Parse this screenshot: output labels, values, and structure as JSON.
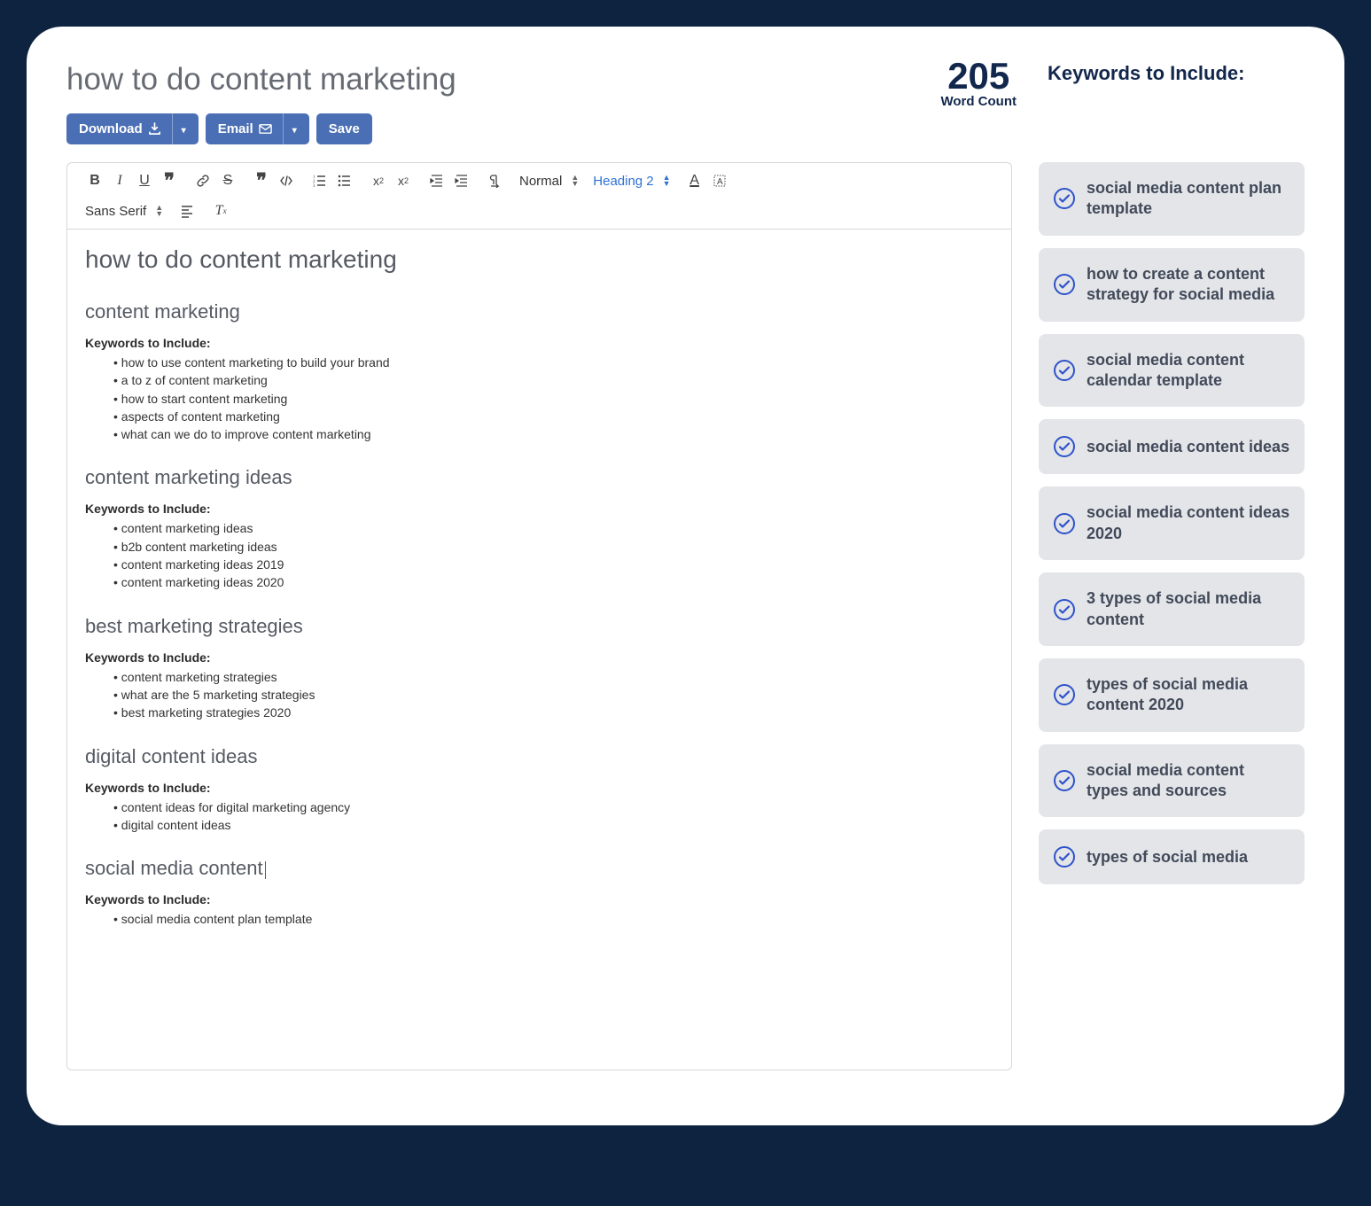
{
  "pageTitle": "how to do content marketing",
  "wordCount": {
    "value": "205",
    "label": "Word Count"
  },
  "buttons": {
    "download": "Download",
    "email": "Email",
    "save": "Save"
  },
  "toolbar": {
    "styleSelect": "Normal",
    "headingSelect": "Heading 2",
    "fontSelect": "Sans Serif"
  },
  "doc": {
    "title": "how to do content marketing",
    "kwLabel": "Keywords to Include:",
    "sections": [
      {
        "heading": "content marketing",
        "keywords": [
          "how to use content marketing to build your brand",
          "a to z of content marketing",
          "how to start content marketing",
          "aspects of content marketing",
          "what can we do to improve content marketing"
        ]
      },
      {
        "heading": "content marketing ideas",
        "keywords": [
          "content marketing ideas",
          "b2b content marketing ideas",
          "content marketing ideas 2019",
          "content marketing ideas 2020"
        ]
      },
      {
        "heading": "best marketing strategies",
        "keywords": [
          "content marketing strategies",
          "what are the 5 marketing strategies",
          "best marketing strategies 2020"
        ]
      },
      {
        "heading": "digital content ideas",
        "keywords": [
          "content ideas for digital marketing agency",
          "digital content ideas"
        ]
      },
      {
        "heading": "social media content",
        "cursor": true,
        "keywords": [
          "social media content plan template"
        ]
      }
    ]
  },
  "sidebar": {
    "title": "Keywords to Include:",
    "items": [
      "social media content plan template",
      "how to create a content strategy for social media",
      "social media content calendar template",
      "social media content ideas",
      "social media content ideas 2020",
      "3 types of social media content",
      "types of social media content 2020",
      "social media content types and sources",
      "types of social media"
    ]
  }
}
